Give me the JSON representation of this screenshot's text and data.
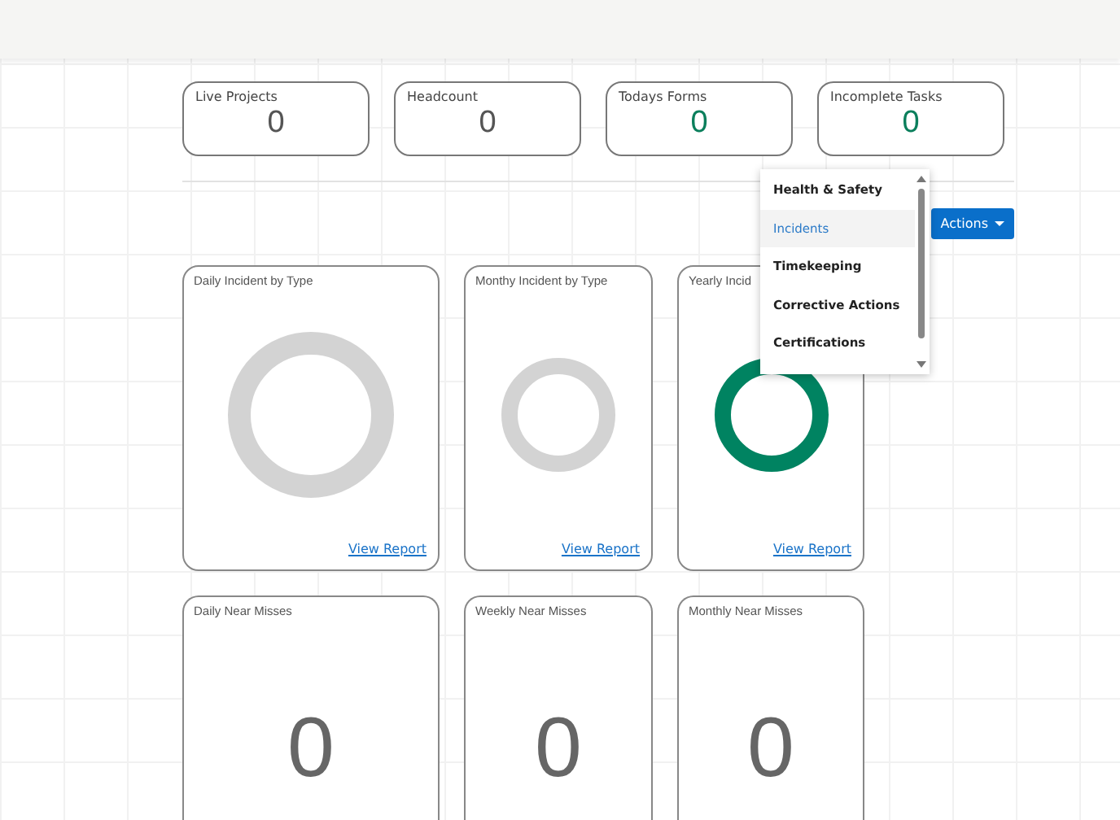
{
  "stats": [
    {
      "label": "Live Projects",
      "value": "0",
      "color": "#555555"
    },
    {
      "label": "Headcount",
      "value": "0",
      "color": "#555555"
    },
    {
      "label": "Todays Forms",
      "value": "0",
      "color": "#0b7f5c"
    },
    {
      "label": "Incomplete Tasks",
      "value": "0",
      "color": "#0b7f5c"
    }
  ],
  "actions_button": {
    "label": "Actions"
  },
  "menu": {
    "items": [
      {
        "label": "Health & Safety",
        "selected": false
      },
      {
        "label": "Incidents",
        "selected": true
      },
      {
        "label": "Timekeeping",
        "selected": false
      },
      {
        "label": "Corrective Actions",
        "selected": false
      },
      {
        "label": "Certifications",
        "selected": false
      }
    ]
  },
  "charts": [
    {
      "title": "Daily Incident by Type",
      "color": "#d3d3d3",
      "link": "View Report"
    },
    {
      "title": "Monthy Incident by Type",
      "color": "#d3d3d3",
      "link": "View Report"
    },
    {
      "title": "Yearly Incid",
      "color": "#008361",
      "link": "View Report"
    }
  ],
  "near_misses": [
    {
      "title": "Daily Near Misses",
      "value": "0"
    },
    {
      "title": "Weekly Near Misses",
      "value": "0"
    },
    {
      "title": "Monthly Near Misses",
      "value": "0"
    }
  ]
}
